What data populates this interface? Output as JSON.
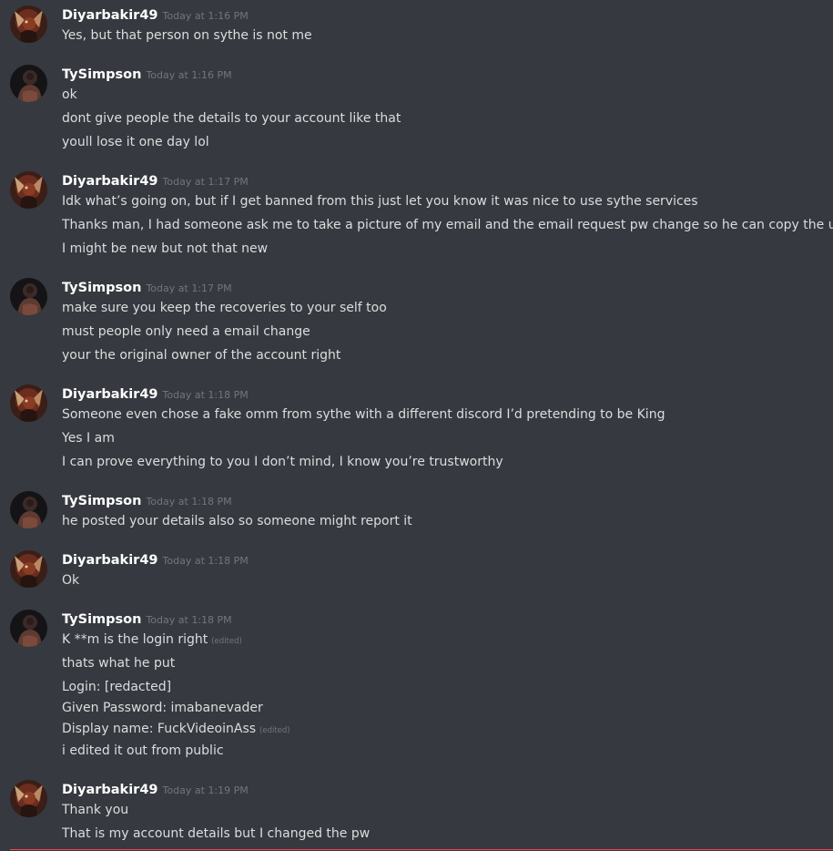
{
  "colors": {
    "background": "#36393f",
    "username": "#ffffff",
    "timestamp": "#72767d",
    "message_text": "#dcddde",
    "new_messages_divider": "#f04747"
  },
  "groups": [
    {
      "author": "Diyarbakir49",
      "timestamp": "Today at 1:16 PM",
      "avatar": "avatar-diyarbakir49",
      "messages": [
        {
          "text": "Yes, but that person on sythe is not me"
        }
      ]
    },
    {
      "author": "TySimpson",
      "timestamp": "Today at 1:16 PM",
      "avatar": "avatar-tysimpson",
      "messages": [
        {
          "text": "ok"
        },
        {
          "text": "dont give people the details to your account like that"
        },
        {
          "text": "youll lose it one day lol"
        }
      ]
    },
    {
      "author": "Diyarbakir49",
      "timestamp": "Today at 1:17 PM",
      "avatar": "avatar-diyarbakir49",
      "messages": [
        {
          "text": "Idk what’s going on, but if I get banned from this just let you know it was nice to use sythe services"
        },
        {
          "text": "Thanks man, I had someone ask me to take a picture of my email and the email request pw change so he can copy the url"
        },
        {
          "text": "I might be new but not that new"
        }
      ]
    },
    {
      "author": "TySimpson",
      "timestamp": "Today at 1:17 PM",
      "avatar": "avatar-tysimpson",
      "messages": [
        {
          "text": "make sure you keep the recoveries to your self too"
        },
        {
          "text": "must people only need a email change"
        },
        {
          "text": "your the original owner of the account right"
        }
      ]
    },
    {
      "author": "Diyarbakir49",
      "timestamp": "Today at 1:18 PM",
      "avatar": "avatar-diyarbakir49",
      "messages": [
        {
          "text": "Someone even chose a fake omm from sythe with a different discord I’d pretending to be King"
        },
        {
          "text": "Yes I am"
        },
        {
          "text": "I can prove everything to you I don’t mind, I know you’re trustworthy"
        }
      ]
    },
    {
      "author": "TySimpson",
      "timestamp": "Today at 1:18 PM",
      "avatar": "avatar-tysimpson",
      "messages": [
        {
          "text": "he posted your details also so someone might report it"
        }
      ]
    },
    {
      "author": "Diyarbakir49",
      "timestamp": "Today at 1:18 PM",
      "avatar": "avatar-diyarbakir49",
      "messages": [
        {
          "text": "Ok"
        }
      ]
    },
    {
      "author": "TySimpson",
      "timestamp": "Today at 1:18 PM",
      "avatar": "avatar-tysimpson",
      "messages": [
        {
          "text": "K **m is the login right",
          "edited": "(edited)"
        },
        {
          "text": "thats what he put"
        },
        {
          "text": "Login: [redacted]"
        },
        {
          "text": "Given Password: imabanevader"
        },
        {
          "text": "Display name: FuckVideoinAss",
          "edited": "(edited)"
        },
        {
          "text": "i edited it out from public"
        }
      ]
    },
    {
      "author": "Diyarbakir49",
      "timestamp": "Today at 1:19 PM",
      "avatar": "avatar-diyarbakir49",
      "messages": [
        {
          "text": "Thank you"
        },
        {
          "text": "That is my account details but I changed the pw"
        }
      ]
    }
  ]
}
